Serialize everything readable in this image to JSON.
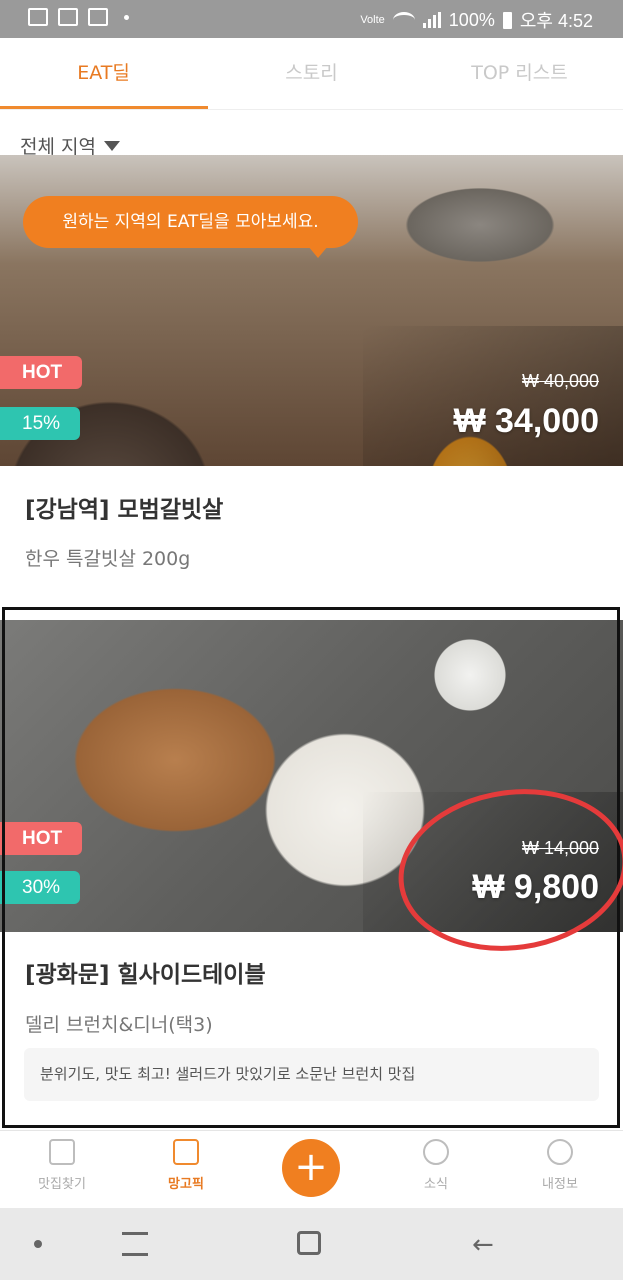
{
  "status_bar": {
    "network": "Volte",
    "battery": "100%",
    "time": "오후 4:52"
  },
  "tabs": [
    {
      "label": "EAT딜",
      "active": true
    },
    {
      "label": "스토리",
      "active": false
    },
    {
      "label": "TOP 리스트",
      "active": false
    }
  ],
  "filter": {
    "region": "전체 지역"
  },
  "tooltip": "원하는 지역의 EAT딜을 모아보세요.",
  "deals": [
    {
      "hot_label": "HOT",
      "discount": "15%",
      "original_price": "₩ 40,000",
      "sale_price": "₩ 34,000",
      "title": "[강남역] 모범갈빗살",
      "subtitle": "한우 특갈빗살 200g"
    },
    {
      "hot_label": "HOT",
      "discount": "30%",
      "original_price": "₩ 14,000",
      "sale_price": "₩ 9,800",
      "title": "[광화문] 힐사이드테이블",
      "subtitle": "델리 브런치&디너(택3)",
      "comment": "분위기도, 맛도 최고! 샐러드가 맛있기로 소문난 브런치 맛집"
    }
  ],
  "bottom_nav": [
    {
      "label": "맛집찾기",
      "icon": "signpost-icon",
      "active": false
    },
    {
      "label": "망고픽",
      "icon": "bookmark-icon",
      "active": true
    },
    {
      "label": "+",
      "icon": "plus-icon",
      "active": false
    },
    {
      "label": "소식",
      "icon": "chat-icon",
      "active": false
    },
    {
      "label": "내정보",
      "icon": "user-icon",
      "active": false
    }
  ],
  "colors": {
    "accent": "#f08a2e",
    "hot": "#f26a6a",
    "discount": "#2ec5b0",
    "annotation": "#e53b3b"
  }
}
